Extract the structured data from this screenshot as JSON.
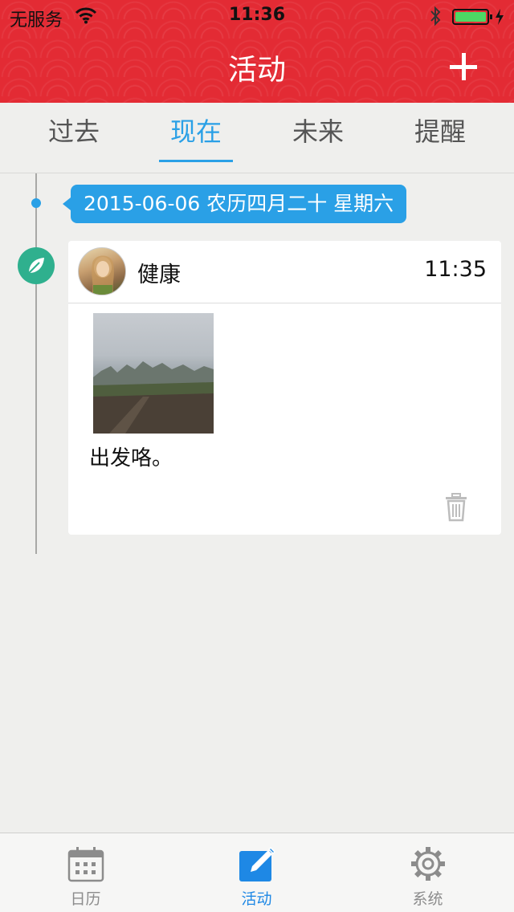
{
  "status_bar": {
    "carrier": "无服务",
    "time": "11:36",
    "icons": [
      "wifi-icon",
      "bluetooth-icon",
      "battery-icon"
    ],
    "battery_level": 1.0
  },
  "nav": {
    "title": "活动",
    "add_icon": "plus-icon"
  },
  "tabs": [
    {
      "label": "过去",
      "active": false
    },
    {
      "label": "现在",
      "active": true
    },
    {
      "label": "未来",
      "active": false
    },
    {
      "label": "提醒",
      "active": false
    }
  ],
  "timeline": {
    "date_label": "2015-06-06 农历四月二十 星期六",
    "entries": [
      {
        "category_icon": "leaf-icon",
        "category": "健康",
        "time": "11:35",
        "text": "出发咯。",
        "delete_icon": "trash-icon"
      }
    ]
  },
  "tabbar": [
    {
      "label": "日历",
      "icon": "calendar-icon",
      "active": false
    },
    {
      "label": "活动",
      "icon": "edit-icon",
      "active": true
    },
    {
      "label": "系统",
      "icon": "gear-icon",
      "active": false
    }
  ],
  "colors": {
    "header_red": "#e32b34",
    "accent_blue": "#2aa0e6",
    "badge_green": "#2fb08e",
    "tab_active_blue": "#1e88e5"
  }
}
